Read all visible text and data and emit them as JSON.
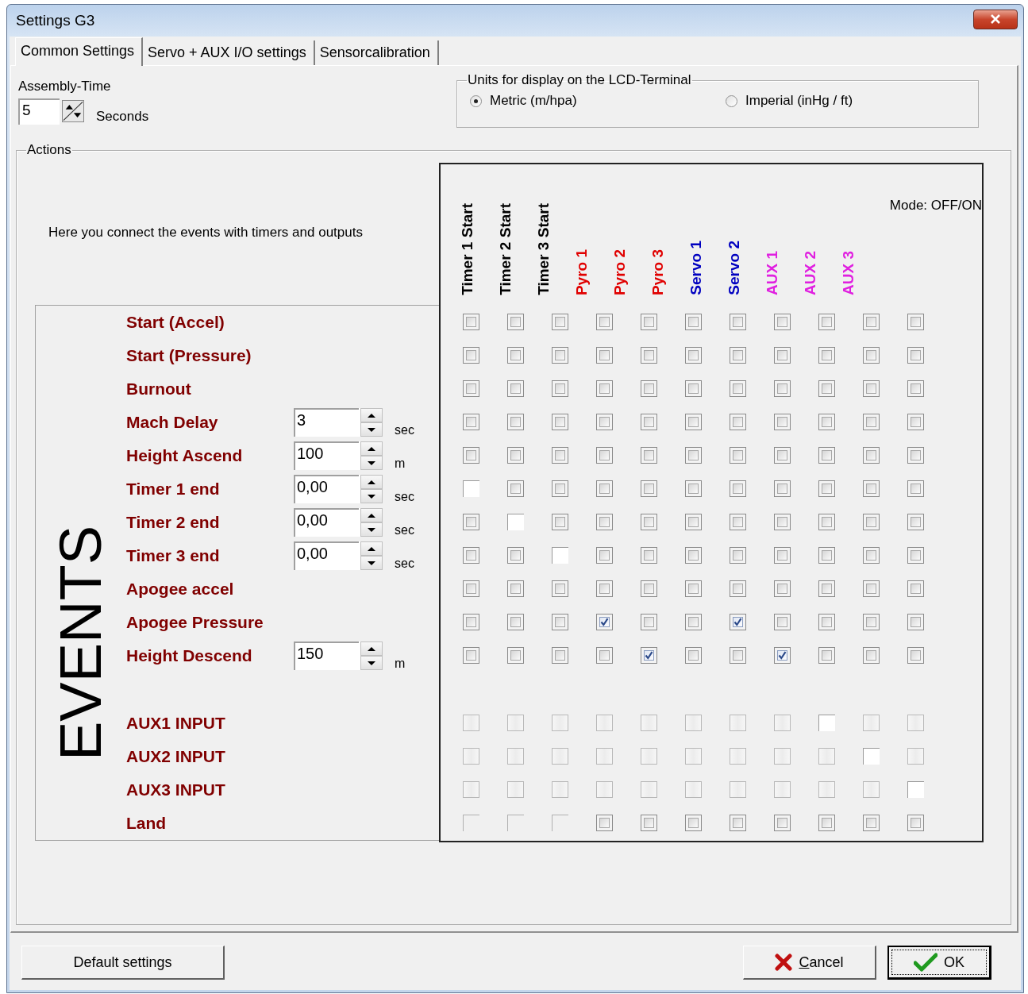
{
  "window": {
    "title": "Settings G3"
  },
  "tabs": [
    {
      "label": "Common Settings",
      "selected": true
    },
    {
      "label": "Servo + AUX I/O settings",
      "selected": false
    },
    {
      "label": "Sensorcalibration",
      "selected": false
    }
  ],
  "assembly_time": {
    "label": "Assembly-Time",
    "value": "5",
    "unit": "Seconds"
  },
  "units": {
    "title": "Units for display on the LCD-Terminal",
    "options": [
      {
        "label": "Metric (m/hpa)",
        "selected": true
      },
      {
        "label": "Imperial (inHg / ft)",
        "selected": false
      }
    ]
  },
  "actions": {
    "title": "Actions",
    "intro": "Here you connect the events with timers and outputs",
    "mode": "Mode: OFF/ON",
    "events_title": "EVENTS",
    "columns": [
      {
        "label": "Timer 1 Start",
        "color": "#000000"
      },
      {
        "label": "Timer 2 Start",
        "color": "#000000"
      },
      {
        "label": "Timer 3 Start",
        "color": "#000000"
      },
      {
        "label": "Pyro 1",
        "color": "#e00000"
      },
      {
        "label": "Pyro 2",
        "color": "#e00000"
      },
      {
        "label": "Pyro 3",
        "color": "#e00000"
      },
      {
        "label": "Servo 1",
        "color": "#0000c0"
      },
      {
        "label": "Servo 2",
        "color": "#0000c0"
      },
      {
        "label": "AUX 1",
        "color": "#e020e0"
      },
      {
        "label": "AUX 2",
        "color": "#e020e0"
      },
      {
        "label": "AUX 3",
        "color": "#e020e0"
      }
    ],
    "events": [
      {
        "label": "Start (Accel)",
        "cells": [
          {
            "kind": "shaded",
            "checked": false
          },
          {
            "kind": "shaded",
            "checked": false
          },
          {
            "kind": "shaded",
            "checked": false
          },
          {
            "kind": "shaded",
            "checked": false
          },
          {
            "kind": "shaded",
            "checked": false
          },
          {
            "kind": "shaded",
            "checked": false
          },
          {
            "kind": "shaded",
            "checked": false
          },
          {
            "kind": "shaded",
            "checked": false
          },
          {
            "kind": "shaded",
            "checked": false
          },
          {
            "kind": "shaded",
            "checked": false
          },
          {
            "kind": "shaded",
            "checked": false
          }
        ]
      },
      {
        "label": "Start (Pressure)",
        "cells": [
          {
            "kind": "shaded",
            "checked": false
          },
          {
            "kind": "shaded",
            "checked": false
          },
          {
            "kind": "shaded",
            "checked": false
          },
          {
            "kind": "shaded",
            "checked": false
          },
          {
            "kind": "shaded",
            "checked": false
          },
          {
            "kind": "shaded",
            "checked": false
          },
          {
            "kind": "shaded",
            "checked": false
          },
          {
            "kind": "shaded",
            "checked": false
          },
          {
            "kind": "shaded",
            "checked": false
          },
          {
            "kind": "shaded",
            "checked": false
          },
          {
            "kind": "shaded",
            "checked": false
          }
        ]
      },
      {
        "label": "Burnout",
        "cells": [
          {
            "kind": "shaded",
            "checked": false
          },
          {
            "kind": "shaded",
            "checked": false
          },
          {
            "kind": "shaded",
            "checked": false
          },
          {
            "kind": "shaded",
            "checked": false
          },
          {
            "kind": "shaded",
            "checked": false
          },
          {
            "kind": "shaded",
            "checked": false
          },
          {
            "kind": "shaded",
            "checked": false
          },
          {
            "kind": "shaded",
            "checked": false
          },
          {
            "kind": "shaded",
            "checked": false
          },
          {
            "kind": "shaded",
            "checked": false
          },
          {
            "kind": "shaded",
            "checked": false
          }
        ]
      },
      {
        "label": "Mach Delay",
        "value": "3",
        "unit": "sec",
        "cells": [
          {
            "kind": "shaded",
            "checked": false
          },
          {
            "kind": "shaded",
            "checked": false
          },
          {
            "kind": "shaded",
            "checked": false
          },
          {
            "kind": "shaded",
            "checked": false
          },
          {
            "kind": "shaded",
            "checked": false
          },
          {
            "kind": "shaded",
            "checked": false
          },
          {
            "kind": "shaded",
            "checked": false
          },
          {
            "kind": "shaded",
            "checked": false
          },
          {
            "kind": "shaded",
            "checked": false
          },
          {
            "kind": "shaded",
            "checked": false
          },
          {
            "kind": "shaded",
            "checked": false
          }
        ]
      },
      {
        "label": "Height Ascend",
        "value": "100",
        "unit": "m",
        "cells": [
          {
            "kind": "shaded",
            "checked": false
          },
          {
            "kind": "shaded",
            "checked": false
          },
          {
            "kind": "shaded",
            "checked": false
          },
          {
            "kind": "shaded",
            "checked": false
          },
          {
            "kind": "shaded",
            "checked": false
          },
          {
            "kind": "shaded",
            "checked": false
          },
          {
            "kind": "shaded",
            "checked": false
          },
          {
            "kind": "shaded",
            "checked": false
          },
          {
            "kind": "shaded",
            "checked": false
          },
          {
            "kind": "shaded",
            "checked": false
          },
          {
            "kind": "shaded",
            "checked": false
          }
        ]
      },
      {
        "label": "Timer 1 end",
        "value": "0,00",
        "unit": "sec",
        "cells": [
          {
            "kind": "plain",
            "checked": false
          },
          {
            "kind": "shaded",
            "checked": false
          },
          {
            "kind": "shaded",
            "checked": false
          },
          {
            "kind": "shaded",
            "checked": false
          },
          {
            "kind": "shaded",
            "checked": false
          },
          {
            "kind": "shaded",
            "checked": false
          },
          {
            "kind": "shaded",
            "checked": false
          },
          {
            "kind": "shaded",
            "checked": false
          },
          {
            "kind": "shaded",
            "checked": false
          },
          {
            "kind": "shaded",
            "checked": false
          },
          {
            "kind": "shaded",
            "checked": false
          }
        ]
      },
      {
        "label": "Timer 2 end",
        "value": "0,00",
        "unit": "sec",
        "cells": [
          {
            "kind": "shaded",
            "checked": false
          },
          {
            "kind": "plain",
            "checked": false
          },
          {
            "kind": "shaded",
            "checked": false
          },
          {
            "kind": "shaded",
            "checked": false
          },
          {
            "kind": "shaded",
            "checked": false
          },
          {
            "kind": "shaded",
            "checked": false
          },
          {
            "kind": "shaded",
            "checked": false
          },
          {
            "kind": "shaded",
            "checked": false
          },
          {
            "kind": "shaded",
            "checked": false
          },
          {
            "kind": "shaded",
            "checked": false
          },
          {
            "kind": "shaded",
            "checked": false
          }
        ]
      },
      {
        "label": "Timer 3 end",
        "value": "0,00",
        "unit": "sec",
        "cells": [
          {
            "kind": "shaded",
            "checked": false
          },
          {
            "kind": "shaded",
            "checked": false
          },
          {
            "kind": "plain",
            "checked": false
          },
          {
            "kind": "shaded",
            "checked": false
          },
          {
            "kind": "shaded",
            "checked": false
          },
          {
            "kind": "shaded",
            "checked": false
          },
          {
            "kind": "shaded",
            "checked": false
          },
          {
            "kind": "shaded",
            "checked": false
          },
          {
            "kind": "shaded",
            "checked": false
          },
          {
            "kind": "shaded",
            "checked": false
          },
          {
            "kind": "shaded",
            "checked": false
          }
        ]
      },
      {
        "label": "Apogee accel",
        "cells": [
          {
            "kind": "shaded",
            "checked": false
          },
          {
            "kind": "shaded",
            "checked": false
          },
          {
            "kind": "shaded",
            "checked": false
          },
          {
            "kind": "shaded",
            "checked": false
          },
          {
            "kind": "shaded",
            "checked": false
          },
          {
            "kind": "shaded",
            "checked": false
          },
          {
            "kind": "shaded",
            "checked": false
          },
          {
            "kind": "shaded",
            "checked": false
          },
          {
            "kind": "shaded",
            "checked": false
          },
          {
            "kind": "shaded",
            "checked": false
          },
          {
            "kind": "shaded",
            "checked": false
          }
        ]
      },
      {
        "label": "Apogee Pressure",
        "cells": [
          {
            "kind": "shaded",
            "checked": false
          },
          {
            "kind": "shaded",
            "checked": false
          },
          {
            "kind": "shaded",
            "checked": false
          },
          {
            "kind": "shaded",
            "checked": true
          },
          {
            "kind": "shaded",
            "checked": false
          },
          {
            "kind": "shaded",
            "checked": false
          },
          {
            "kind": "shaded",
            "checked": true
          },
          {
            "kind": "shaded",
            "checked": false
          },
          {
            "kind": "shaded",
            "checked": false
          },
          {
            "kind": "shaded",
            "checked": false
          },
          {
            "kind": "shaded",
            "checked": false
          }
        ]
      },
      {
        "label": "Height Descend",
        "value": "150",
        "unit": "m",
        "cells": [
          {
            "kind": "shaded",
            "checked": false
          },
          {
            "kind": "shaded",
            "checked": false
          },
          {
            "kind": "shaded",
            "checked": false
          },
          {
            "kind": "shaded",
            "checked": false
          },
          {
            "kind": "shaded",
            "checked": true
          },
          {
            "kind": "shaded",
            "checked": false
          },
          {
            "kind": "shaded",
            "checked": false
          },
          {
            "kind": "shaded",
            "checked": true
          },
          {
            "kind": "shaded",
            "checked": false
          },
          {
            "kind": "shaded",
            "checked": false
          },
          {
            "kind": "shaded",
            "checked": false
          }
        ]
      },
      {
        "label": "AUX1 INPUT",
        "group_start": true,
        "cells": [
          {
            "kind": "faded",
            "checked": false
          },
          {
            "kind": "faded",
            "checked": false
          },
          {
            "kind": "faded",
            "checked": false
          },
          {
            "kind": "faded",
            "checked": false
          },
          {
            "kind": "faded",
            "checked": false
          },
          {
            "kind": "faded",
            "checked": false
          },
          {
            "kind": "faded",
            "checked": false
          },
          {
            "kind": "faded",
            "checked": false
          },
          {
            "kind": "plain",
            "checked": false
          },
          {
            "kind": "faded",
            "checked": false
          },
          {
            "kind": "faded",
            "checked": false
          }
        ]
      },
      {
        "label": "AUX2 INPUT",
        "cells": [
          {
            "kind": "faded",
            "checked": false
          },
          {
            "kind": "faded",
            "checked": false
          },
          {
            "kind": "faded",
            "checked": false
          },
          {
            "kind": "faded",
            "checked": false
          },
          {
            "kind": "faded",
            "checked": false
          },
          {
            "kind": "faded",
            "checked": false
          },
          {
            "kind": "faded",
            "checked": false
          },
          {
            "kind": "faded",
            "checked": false
          },
          {
            "kind": "faded",
            "checked": false
          },
          {
            "kind": "plain",
            "checked": false
          },
          {
            "kind": "faded",
            "checked": false
          }
        ]
      },
      {
        "label": "AUX3 INPUT",
        "cells": [
          {
            "kind": "faded",
            "checked": false
          },
          {
            "kind": "faded",
            "checked": false
          },
          {
            "kind": "faded",
            "checked": false
          },
          {
            "kind": "faded",
            "checked": false
          },
          {
            "kind": "faded",
            "checked": false
          },
          {
            "kind": "faded",
            "checked": false
          },
          {
            "kind": "faded",
            "checked": false
          },
          {
            "kind": "faded",
            "checked": false
          },
          {
            "kind": "faded",
            "checked": false
          },
          {
            "kind": "faded",
            "checked": false
          },
          {
            "kind": "plain",
            "checked": false
          }
        ]
      },
      {
        "label": "Land",
        "cells": [
          {
            "kind": "empty",
            "checked": false
          },
          {
            "kind": "empty",
            "checked": false
          },
          {
            "kind": "empty",
            "checked": false
          },
          {
            "kind": "shaded",
            "checked": false
          },
          {
            "kind": "shaded",
            "checked": false
          },
          {
            "kind": "shaded",
            "checked": false
          },
          {
            "kind": "shaded",
            "checked": false
          },
          {
            "kind": "shaded",
            "checked": false
          },
          {
            "kind": "shaded",
            "checked": false
          },
          {
            "kind": "shaded",
            "checked": false
          },
          {
            "kind": "shaded",
            "checked": false
          }
        ]
      }
    ]
  },
  "buttons": [
    {
      "label": "Default settings",
      "kind": "default",
      "focused": false
    },
    {
      "label": "Cancel",
      "kind": "cancel",
      "focused": false
    },
    {
      "label": "OK",
      "kind": "ok",
      "focused": true
    }
  ]
}
